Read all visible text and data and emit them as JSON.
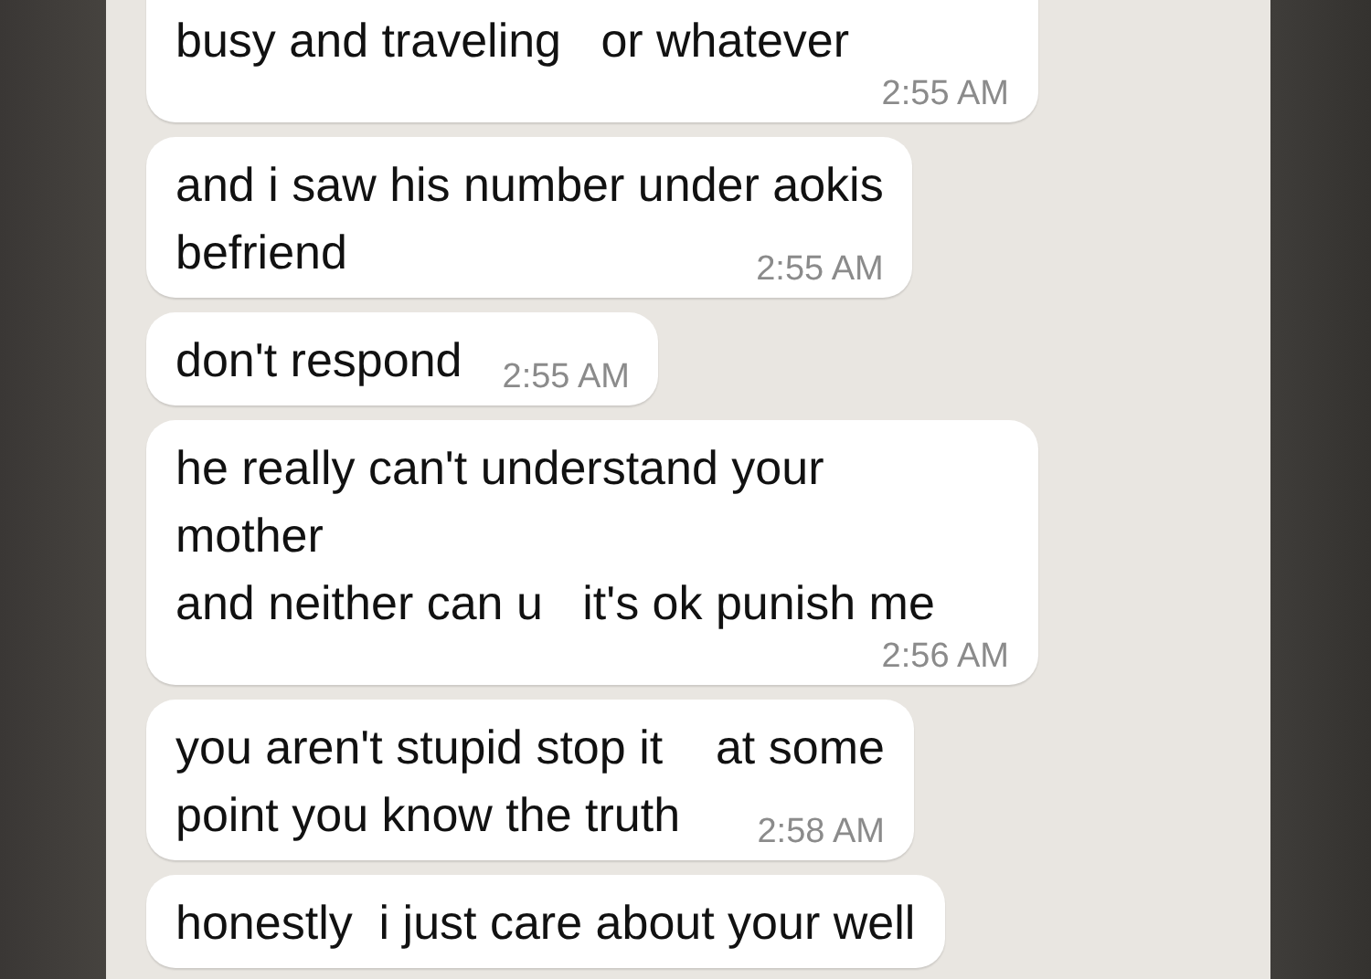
{
  "messages": [
    {
      "lines": [
        "busy and traveling   or whatever"
      ],
      "time": "2:55 AM"
    },
    {
      "lines": [
        "and i saw his number under aokis",
        "befriend"
      ],
      "time": "2:55 AM"
    },
    {
      "lines": [
        "don't respond"
      ],
      "time": "2:55 AM"
    },
    {
      "lines": [
        "he really can't understand your",
        "mother",
        "and neither can u   it's ok punish me"
      ],
      "time": "2:56 AM"
    },
    {
      "lines": [
        "you aren't stupid stop it    at some",
        "point you know the truth"
      ],
      "time": "2:58 AM"
    },
    {
      "lines": [
        "honestly  i just care about your well"
      ]
    }
  ]
}
